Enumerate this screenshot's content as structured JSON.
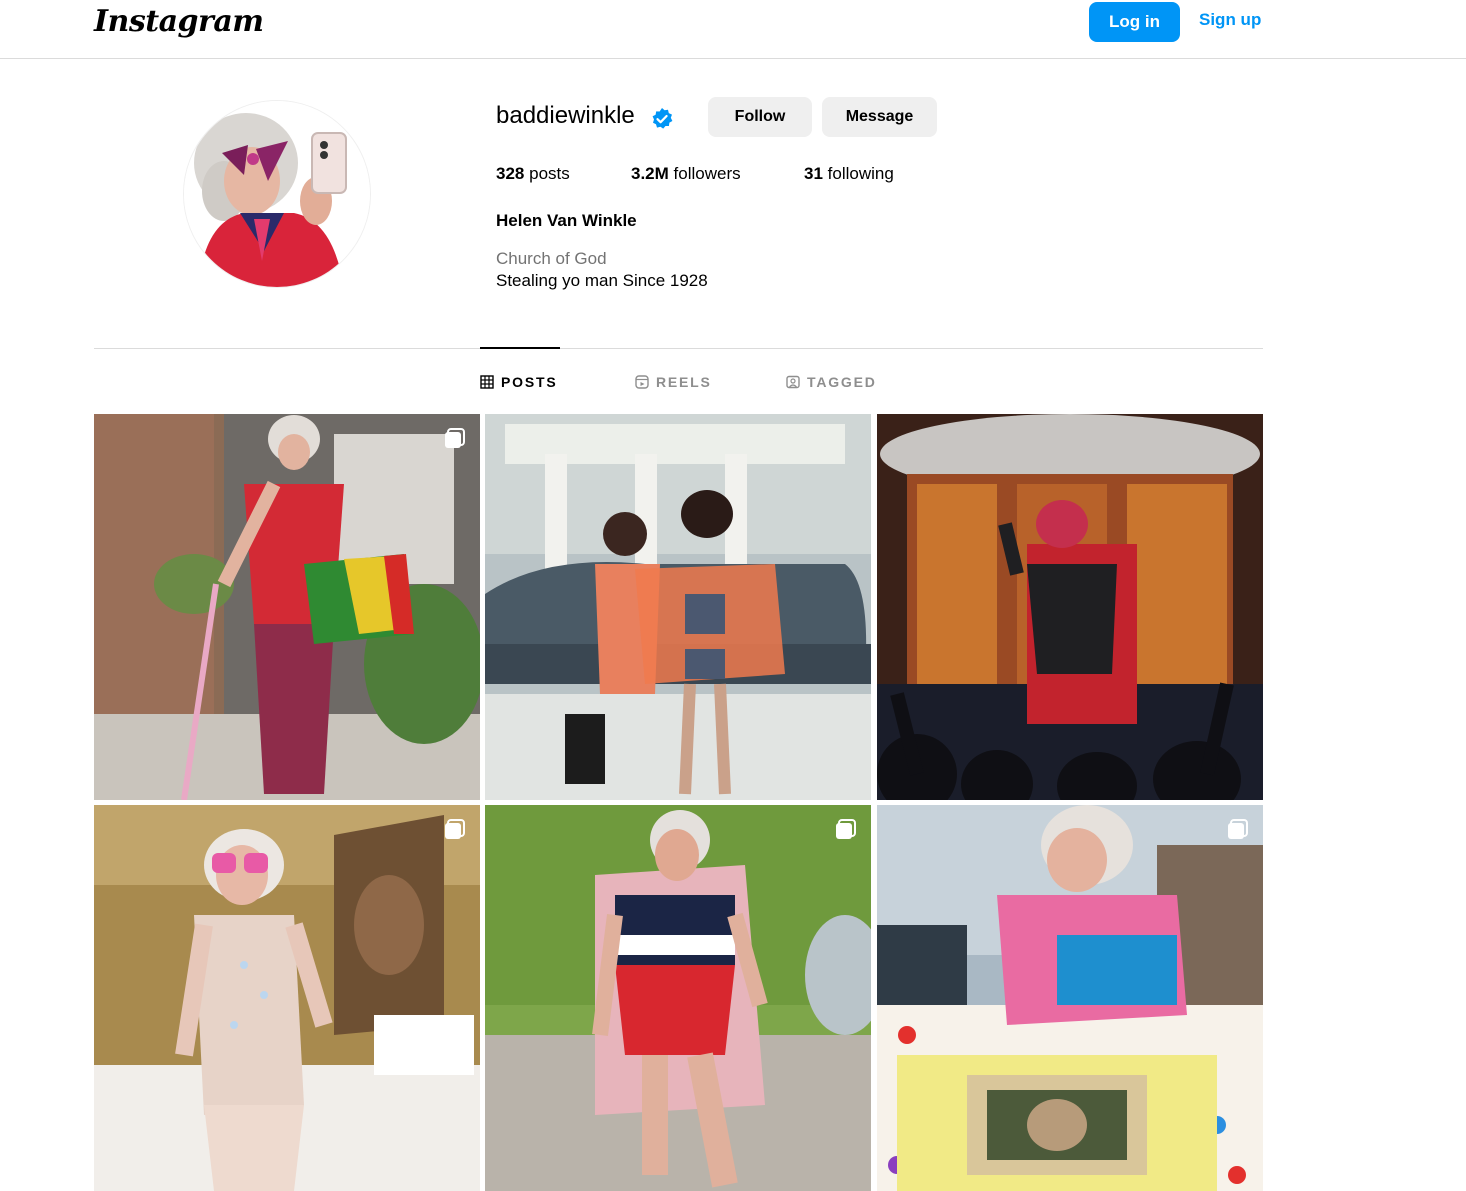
{
  "header": {
    "logo": "Instagram",
    "login_label": "Log in",
    "signup_label": "Sign up"
  },
  "profile": {
    "username": "baddiewinkle",
    "verified": true,
    "follow_label": "Follow",
    "message_label": "Message",
    "stats": {
      "posts_count": "328",
      "posts_label": "posts",
      "followers_count": "3.2M",
      "followers_label": "followers",
      "following_count": "31",
      "following_label": "following"
    },
    "full_name": "Helen Van Winkle",
    "category": "Church of God",
    "bio": "Stealing yo man Since 1928"
  },
  "tabs": [
    {
      "label": "POSTS",
      "icon": "grid-icon",
      "active": true
    },
    {
      "label": "REELS",
      "icon": "reels-icon",
      "active": false
    },
    {
      "label": "TAGGED",
      "icon": "tagged-icon",
      "active": false
    }
  ],
  "posts": [
    {
      "multi": true
    },
    {
      "multi": false
    },
    {
      "multi": false
    },
    {
      "multi": true
    },
    {
      "multi": true
    },
    {
      "multi": true
    }
  ],
  "colors": {
    "accent": "#0095f6",
    "button_gray": "#efefef",
    "divider": "#dbdbdb",
    "muted_text": "#737373",
    "verified_badge": "#0095f6"
  }
}
